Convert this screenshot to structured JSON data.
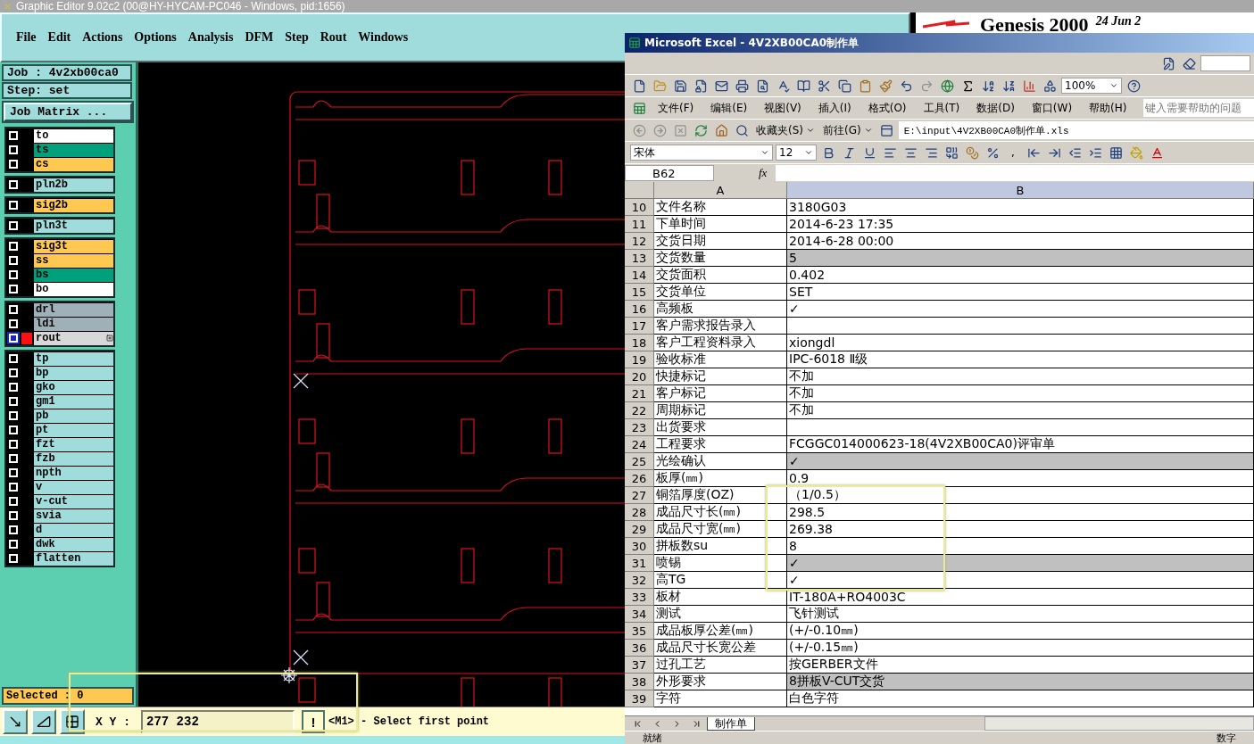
{
  "genesis": {
    "title": "Graphic Editor 9.02c2 (00@HY-HYCAM-PC046 - Windows, pid:1656)",
    "menu": [
      "File",
      "Edit",
      "Actions",
      "Options",
      "Analysis",
      "DFM",
      "Step",
      "Rout",
      "Windows"
    ],
    "logo": {
      "product": "Genesis 2000",
      "date": "24 Jun 2"
    },
    "job": "Job : 4v2xb00ca0",
    "step": "Step: set",
    "job_matrix_button": "Job Matrix ...",
    "layer_groups": [
      [
        {
          "name": "to",
          "color": "#ffffff",
          "selected": false
        },
        {
          "name": "ts",
          "color": "#00a07c",
          "selected": false
        },
        {
          "name": "cs",
          "color": "#ffc850",
          "selected": false
        }
      ],
      [
        {
          "name": "pln2b",
          "color": "#a0dcdc",
          "selected": false
        }
      ],
      [
        {
          "name": "sig2b",
          "color": "#ffc850",
          "selected": false
        }
      ],
      [
        {
          "name": "pln3t",
          "color": "#a0dcdc",
          "selected": false
        }
      ],
      [
        {
          "name": "sig3t",
          "color": "#ffc850",
          "selected": false
        },
        {
          "name": "ss",
          "color": "#ffc850",
          "selected": false
        },
        {
          "name": "bs",
          "color": "#00a07c",
          "selected": false
        },
        {
          "name": "bo",
          "color": "#ffffff",
          "selected": false
        }
      ],
      [
        {
          "name": "drl",
          "color": "#a0b0b8",
          "selected": false
        },
        {
          "name": "ldi",
          "color": "#a0b0b8",
          "selected": false
        },
        {
          "name": "rout",
          "color": "#d8d8d8",
          "selected": true
        }
      ],
      [
        {
          "name": "tp",
          "color": "#a0dcdc",
          "selected": false
        },
        {
          "name": "bp",
          "color": "#a0dcdc",
          "selected": false
        },
        {
          "name": "gko",
          "color": "#a0dcdc",
          "selected": false
        },
        {
          "name": "gm1",
          "color": "#a0dcdc",
          "selected": false
        },
        {
          "name": "pb",
          "color": "#a0dcdc",
          "selected": false
        },
        {
          "name": "pt",
          "color": "#a0dcdc",
          "selected": false
        },
        {
          "name": "fzt",
          "color": "#a0dcdc",
          "selected": false
        },
        {
          "name": "fzb",
          "color": "#a0dcdc",
          "selected": false
        },
        {
          "name": "npth",
          "color": "#a0dcdc",
          "selected": false
        },
        {
          "name": "v",
          "color": "#a0dcdc",
          "selected": false
        },
        {
          "name": "v-cut",
          "color": "#a0dcdc",
          "selected": false
        },
        {
          "name": "svia",
          "color": "#a0dcdc",
          "selected": false
        },
        {
          "name": "d",
          "color": "#a0dcdc",
          "selected": false
        },
        {
          "name": "dwk",
          "color": "#a0dcdc",
          "selected": false
        },
        {
          "name": "flatten",
          "color": "#a0dcdc",
          "selected": false
        }
      ]
    ],
    "selected_count": "Selected : 0",
    "coord_label": "X Y :",
    "coord_value": "277 232",
    "alert_button": "!",
    "prompt": "<M1> - Select first point"
  },
  "excel": {
    "title": "Microsoft Excel - 4V2XB00CA0制作单",
    "zoom": "100%",
    "menu": [
      "文件(F)",
      "编辑(E)",
      "视图(V)",
      "插入(I)",
      "格式(O)",
      "工具(T)",
      "数据(D)",
      "窗口(W)",
      "帮助(H)"
    ],
    "help_placeholder": "键入需要帮助的问题",
    "favorites": "收藏夹(S)",
    "goto": "前往(G)",
    "address": "E:\\input\\4V2XB00CA0制作单.xls",
    "font": "宋体",
    "size": "12",
    "comma_button": ",",
    "name_box": "B62",
    "fx": "fx",
    "columns": [
      "A",
      "B"
    ],
    "rows": [
      {
        "num": "10",
        "a": "文件名称",
        "b": "3180G03",
        "shaded": false
      },
      {
        "num": "11",
        "a": "下单时间",
        "b": "2014-6-23 17:35",
        "shaded": false
      },
      {
        "num": "12",
        "a": "交货日期",
        "b": "2014-6-28 00:00",
        "shaded": false
      },
      {
        "num": "13",
        "a": "交货数量",
        "b": "5",
        "shaded": true
      },
      {
        "num": "14",
        "a": "交货面积",
        "b": "0.402",
        "shaded": false
      },
      {
        "num": "15",
        "a": "交货单位",
        "b": "SET",
        "shaded": false
      },
      {
        "num": "16",
        "a": "高频板",
        "b": "✓",
        "shaded": false
      },
      {
        "num": "17",
        "a": "客户需求报告录入",
        "b": "",
        "shaded": false
      },
      {
        "num": "18",
        "a": "客户工程资料录入",
        "b": "xiongdl",
        "shaded": false
      },
      {
        "num": "19",
        "a": "验收标准",
        "b": "IPC-6018 Ⅱ级",
        "shaded": false
      },
      {
        "num": "20",
        "a": "快捷标记",
        "b": "不加",
        "shaded": false
      },
      {
        "num": "21",
        "a": "客户标记",
        "b": "不加",
        "shaded": false
      },
      {
        "num": "22",
        "a": "周期标记",
        "b": "不加",
        "shaded": false
      },
      {
        "num": "23",
        "a": "出货要求",
        "b": "",
        "shaded": false
      },
      {
        "num": "24",
        "a": "工程要求",
        "b": "FCGGC014000623-18(4V2XB00CA0)评审单",
        "shaded": false
      },
      {
        "num": "25",
        "a": "光绘确认",
        "b": "✓",
        "shaded": true
      },
      {
        "num": "26",
        "a": "板厚(㎜)",
        "b": "0.9",
        "shaded": false
      },
      {
        "num": "27",
        "a": "铜箔厚度(OZ)",
        "b": "（1/0.5）",
        "shaded": false
      },
      {
        "num": "28",
        "a": "成品尺寸长(㎜)",
        "b": "298.5",
        "shaded": false
      },
      {
        "num": "29",
        "a": "成品尺寸宽(㎜)",
        "b": "269.38",
        "shaded": false
      },
      {
        "num": "30",
        "a": "拼板数su",
        "b": "8",
        "shaded": false
      },
      {
        "num": "31",
        "a": "喷锡",
        "b": "✓",
        "shaded": true
      },
      {
        "num": "32",
        "a": "高TG",
        "b": "✓",
        "shaded": false
      },
      {
        "num": "33",
        "a": "板材",
        "b": "IT-180A+RO4003C",
        "shaded": false
      },
      {
        "num": "34",
        "a": "测试",
        "b": "飞针测试",
        "shaded": false
      },
      {
        "num": "35",
        "a": "成品板厚公差(㎜)",
        "b": "(+/-0.10㎜)",
        "shaded": false
      },
      {
        "num": "36",
        "a": "成品尺寸长宽公差",
        "b": "(+/-0.15㎜)",
        "shaded": false
      },
      {
        "num": "37",
        "a": "过孔工艺",
        "b": "按GERBER文件",
        "shaded": false
      },
      {
        "num": "38",
        "a": "外形要求",
        "b": "8拼板V-CUT交货",
        "shaded": true
      },
      {
        "num": "39",
        "a": "字符",
        "b": "白色字符",
        "shaded": false
      }
    ],
    "sheet_tabs": [
      {
        "label": "制作单",
        "selected": true
      }
    ],
    "status": "就绪",
    "num_indicator": "数字"
  }
}
